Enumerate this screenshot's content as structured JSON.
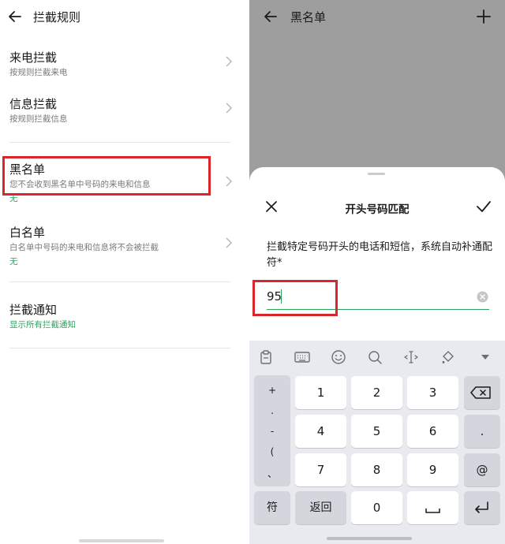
{
  "left": {
    "title": "拦截规则",
    "items": [
      {
        "title": "来电拦截",
        "subtitle": "按规则拦截来电"
      },
      {
        "title": "信息拦截",
        "subtitle": "按规则拦截信息"
      },
      {
        "title": "黑名单",
        "subtitle": "您不会收到黑名单中号码的来电和信息",
        "state": "无"
      },
      {
        "title": "白名单",
        "subtitle": "白名单中号码的来电和信息将不会被拦截",
        "state": "无"
      },
      {
        "title": "拦截通知",
        "state": "显示所有拦截通知"
      }
    ]
  },
  "right": {
    "title": "黑名单",
    "sheet": {
      "title": "开头号码匹配",
      "description": "拦截特定号码开头的电话和短信，系统自动补通配符*",
      "input_value": "95"
    },
    "keyboard": {
      "tools": [
        "clipboard-icon",
        "keyboard-icon",
        "emoji-icon",
        "search-icon",
        "cursor-icon",
        "theme-icon",
        "collapse-icon"
      ],
      "symbols": [
        "+",
        ".",
        "-",
        "(",
        "、"
      ],
      "keys": {
        "k1": "1",
        "k2": "2",
        "k3": "3",
        "k4": "4",
        "k5": "5",
        "k6": "6",
        "k7": "7",
        "k8": "8",
        "k9": "9",
        "k0": "0",
        "dot": ".",
        "at": "@",
        "fu": "符",
        "back": "返回"
      }
    }
  },
  "colors": {
    "accent_green": "#2ba55e",
    "highlight_red": "#d9262a",
    "overlay_gray": "#9e9e9e",
    "keyboard_bg": "#e8eaef"
  }
}
